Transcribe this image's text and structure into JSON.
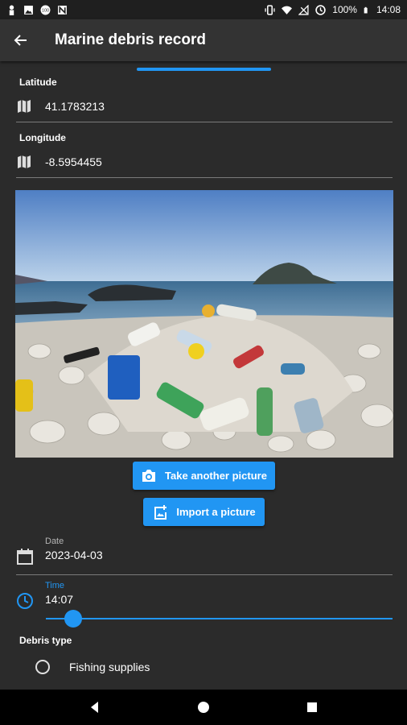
{
  "status_bar": {
    "battery": "100%",
    "time": "14:08",
    "icons": [
      "person-icon",
      "image-icon",
      "sim-icon",
      "n-icon",
      "vibrate-icon",
      "wifi-icon",
      "no-signal-icon",
      "alarm-icon",
      "battery-icon"
    ]
  },
  "app_bar": {
    "title": "Marine debris record",
    "back_icon": "arrow-back-icon"
  },
  "latitude": {
    "label": "Latitude",
    "value": "41.1783213",
    "icon": "map-icon"
  },
  "longitude": {
    "label": "Longitude",
    "value": "-8.5954455",
    "icon": "map-icon"
  },
  "photo": {
    "subject": "Beach with plastic debris pile and island"
  },
  "buttons": {
    "take_picture": "Take another picture",
    "import_picture": "Import a picture"
  },
  "date": {
    "label": "Date",
    "value": "2023-04-03",
    "icon": "calendar-icon"
  },
  "time": {
    "label": "Time",
    "value": "14:07",
    "icon": "clock-icon"
  },
  "slider": {
    "value": 0.08
  },
  "debris_type": {
    "label": "Debris type",
    "options": [
      "Fishing supplies"
    ]
  },
  "colors": {
    "accent": "#2196f3",
    "background": "#2b2b2b",
    "appbar": "#333333"
  }
}
